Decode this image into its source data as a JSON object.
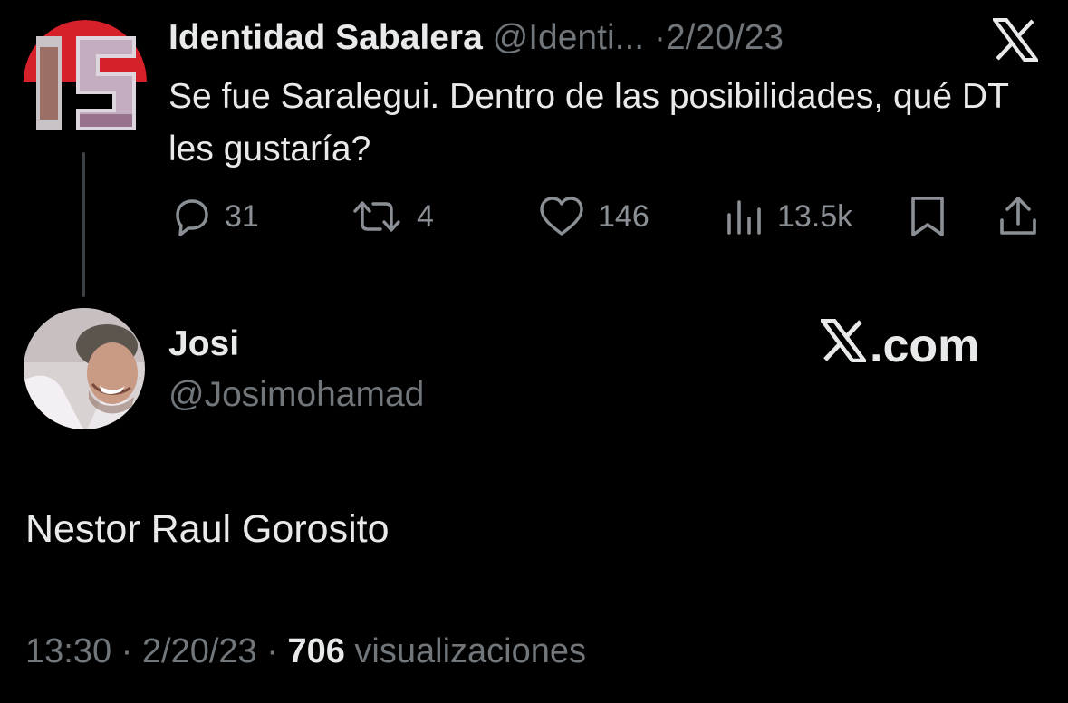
{
  "original_tweet": {
    "author_name": "Identidad Sabalera",
    "author_handle": "@Identi...",
    "separator": "·",
    "date": "2/20/23",
    "text": "Se fue Saralegui. Dentro de las posibilidades, qué DT les gustaría?",
    "avatar_lettering": "IS",
    "actions": {
      "replies": "31",
      "retweets": "4",
      "likes": "146",
      "views": "13.5k"
    }
  },
  "reply_tweet": {
    "author_name": "Josi",
    "author_handle": "@Josimohamad",
    "text": "Nestor Raul Gorosito",
    "time": "13:30",
    "date": "2/20/23",
    "separator": "·",
    "views_count": "706",
    "views_label": "visualizaciones"
  },
  "brand": {
    "watermark": ".com"
  },
  "icons": {
    "top_right": "x-logo-icon",
    "reply": "reply-bubble-icon",
    "retweet": "retweet-icon",
    "like": "heart-icon",
    "views": "views-bars-icon",
    "bookmark": "bookmark-icon",
    "share": "share-icon"
  },
  "colors": {
    "background": "#000000",
    "primary_text": "#e7e9ea",
    "secondary_text": "#71767b",
    "action_icons": "#8b9096",
    "logo_red": "#d6202a"
  }
}
